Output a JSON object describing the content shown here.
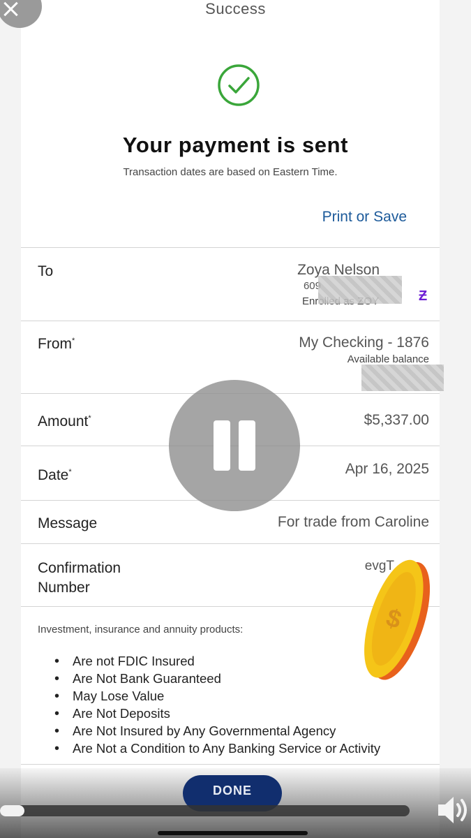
{
  "header": {
    "title": "Success"
  },
  "confirmation": {
    "heading": "Your payment is sent",
    "subheading": "Transaction dates are based on Eastern Time.",
    "print_label": "Print or Save"
  },
  "details": {
    "to": {
      "label": "To",
      "name": "Zoya Nelson",
      "phone_partial": "609",
      "enrolled_partial": "Enrolled as ZOY"
    },
    "from": {
      "label": "From",
      "marker": "*",
      "account": "My Checking - 1876",
      "balance_label": "Available balance"
    },
    "amount": {
      "label": "Amount",
      "marker": "*",
      "value": "$5,337.00"
    },
    "date": {
      "label": "Date",
      "marker": "*",
      "value": "Apr 16, 2025"
    },
    "message": {
      "label": "Message",
      "value": "For trade from Caroline"
    },
    "confirmation_number": {
      "label_line1": "Confirmation",
      "label_line2": "Number",
      "value_partial": "evgT"
    }
  },
  "disclaimer": {
    "title": "Investment, insurance and annuity products:",
    "items": [
      "Are not FDIC Insured",
      "Are Not Bank Guaranteed",
      "May Lose Value",
      "Are Not Deposits",
      "Are Not Insured by Any Governmental Agency",
      "Are Not a Condition to Any Banking Service or Activity"
    ]
  },
  "footer": {
    "done_label": "DONE"
  },
  "player": {
    "progress_fraction": 0.06
  },
  "colors": {
    "accent_link": "#1c5a9a",
    "success_green": "#3aa63a",
    "button_navy": "#112e6e",
    "zelle_purple": "#6d1ed4"
  },
  "icons": {
    "close": "close-icon",
    "check": "check-circle-icon",
    "zelle": "zelle-icon",
    "pause": "pause-icon",
    "volume": "volume-icon",
    "coin": "coin-sticker"
  }
}
